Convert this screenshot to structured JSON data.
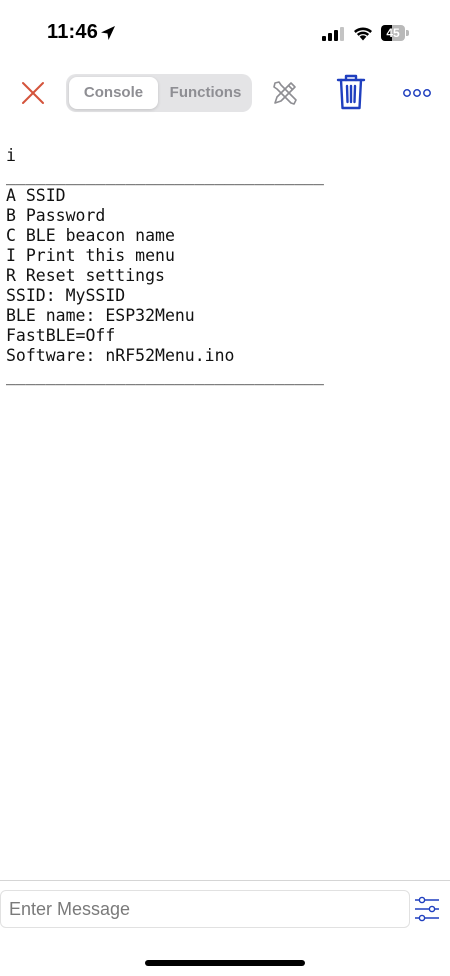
{
  "status_bar": {
    "time": "11:46",
    "battery_level": "45",
    "battery_fraction": 0.45
  },
  "toolbar": {
    "tabs": [
      {
        "label": "Console",
        "selected": true
      },
      {
        "label": "Functions",
        "selected": false
      }
    ],
    "icons": {
      "close": "close-icon",
      "tools": "tools-icon",
      "trash": "trash-icon",
      "more": "more-icon"
    }
  },
  "console": {
    "lines": [
      "i",
      "________________________________",
      "A SSID",
      "B Password",
      "C BLE beacon name",
      "I Print this menu",
      "R Reset settings",
      "SSID: MySSID",
      "BLE name: ESP32Menu",
      "FastBLE=Off",
      "Software: nRF52Menu.ino",
      "________________________________"
    ]
  },
  "input": {
    "placeholder": "Enter Message",
    "value": ""
  },
  "colors": {
    "accent": "#1f3fbf",
    "close_red": "#d4543c",
    "tab_bg": "#e4e4e6",
    "tab_text": "#8e8e93"
  }
}
